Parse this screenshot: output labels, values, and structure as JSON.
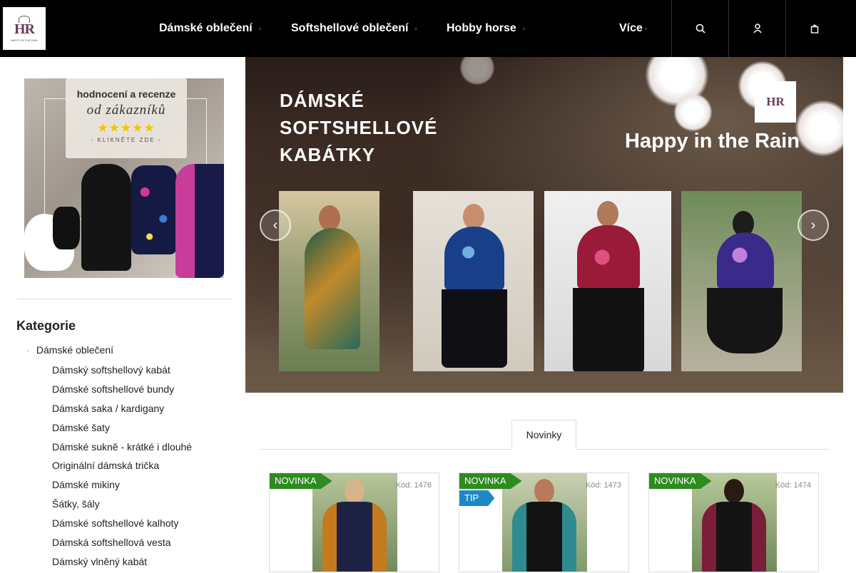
{
  "header": {
    "logo_text": "HR",
    "logo_sub": "HAPPY IN THE RAIN",
    "nav": [
      {
        "label": "Dámské oblečení"
      },
      {
        "label": "Softshellové oblečení"
      },
      {
        "label": "Hobby horse"
      },
      {
        "label": "Více"
      }
    ],
    "caret": "▫",
    "icons": [
      "search-icon",
      "user-icon",
      "cart-icon"
    ]
  },
  "sidebar": {
    "promo": {
      "line1": "hodnocení a recenze",
      "line2": "od zákazníků",
      "stars": "★★★★★",
      "line3": "- KLIKNĚTE ZDE -"
    },
    "categories_title": "Kategorie",
    "parent_category": "Dámské oblečení",
    "bullet": "▫",
    "subcategories": [
      "Dámský softshellový kabát",
      "Dámské softshellové bundy",
      "Dámská saka / kardigany",
      "Dámské šaty",
      "Dámské sukně - krátké i dlouhé",
      "Originální dámská trička",
      "Dámské mikiny",
      "Šátky, šály",
      "Dámské softshellové kalhoty",
      "Dámská softshellová vesta",
      "Dámský vlněný kabát"
    ]
  },
  "hero": {
    "title_lines": [
      "DÁMSKÉ",
      "SOFTSHELLOVÉ",
      "KABÁTKY"
    ],
    "brand": "Happy in the Rain",
    "logo_text": "HR",
    "prev_arrow": "‹",
    "next_arrow": "›"
  },
  "tabs": {
    "active": "Novinky"
  },
  "products": [
    {
      "badge": "NOVINKA",
      "tip": "",
      "kod": "Kód: 1476",
      "accent": "#c57a1e",
      "body": "#1d2244"
    },
    {
      "badge": "NOVINKA",
      "tip": "TIP",
      "kod": "Kód: 1473",
      "accent": "#2f8b8f",
      "body": "#141414"
    },
    {
      "badge": "NOVINKA",
      "tip": "",
      "kod": "Kód: 1474",
      "accent": "#7a1e3a",
      "body": "#141414"
    }
  ],
  "colors": {
    "header_bg": "#000000",
    "badge_new": "#2e8b1f",
    "badge_tip": "#1e88c7",
    "stars": "#f4c400"
  }
}
